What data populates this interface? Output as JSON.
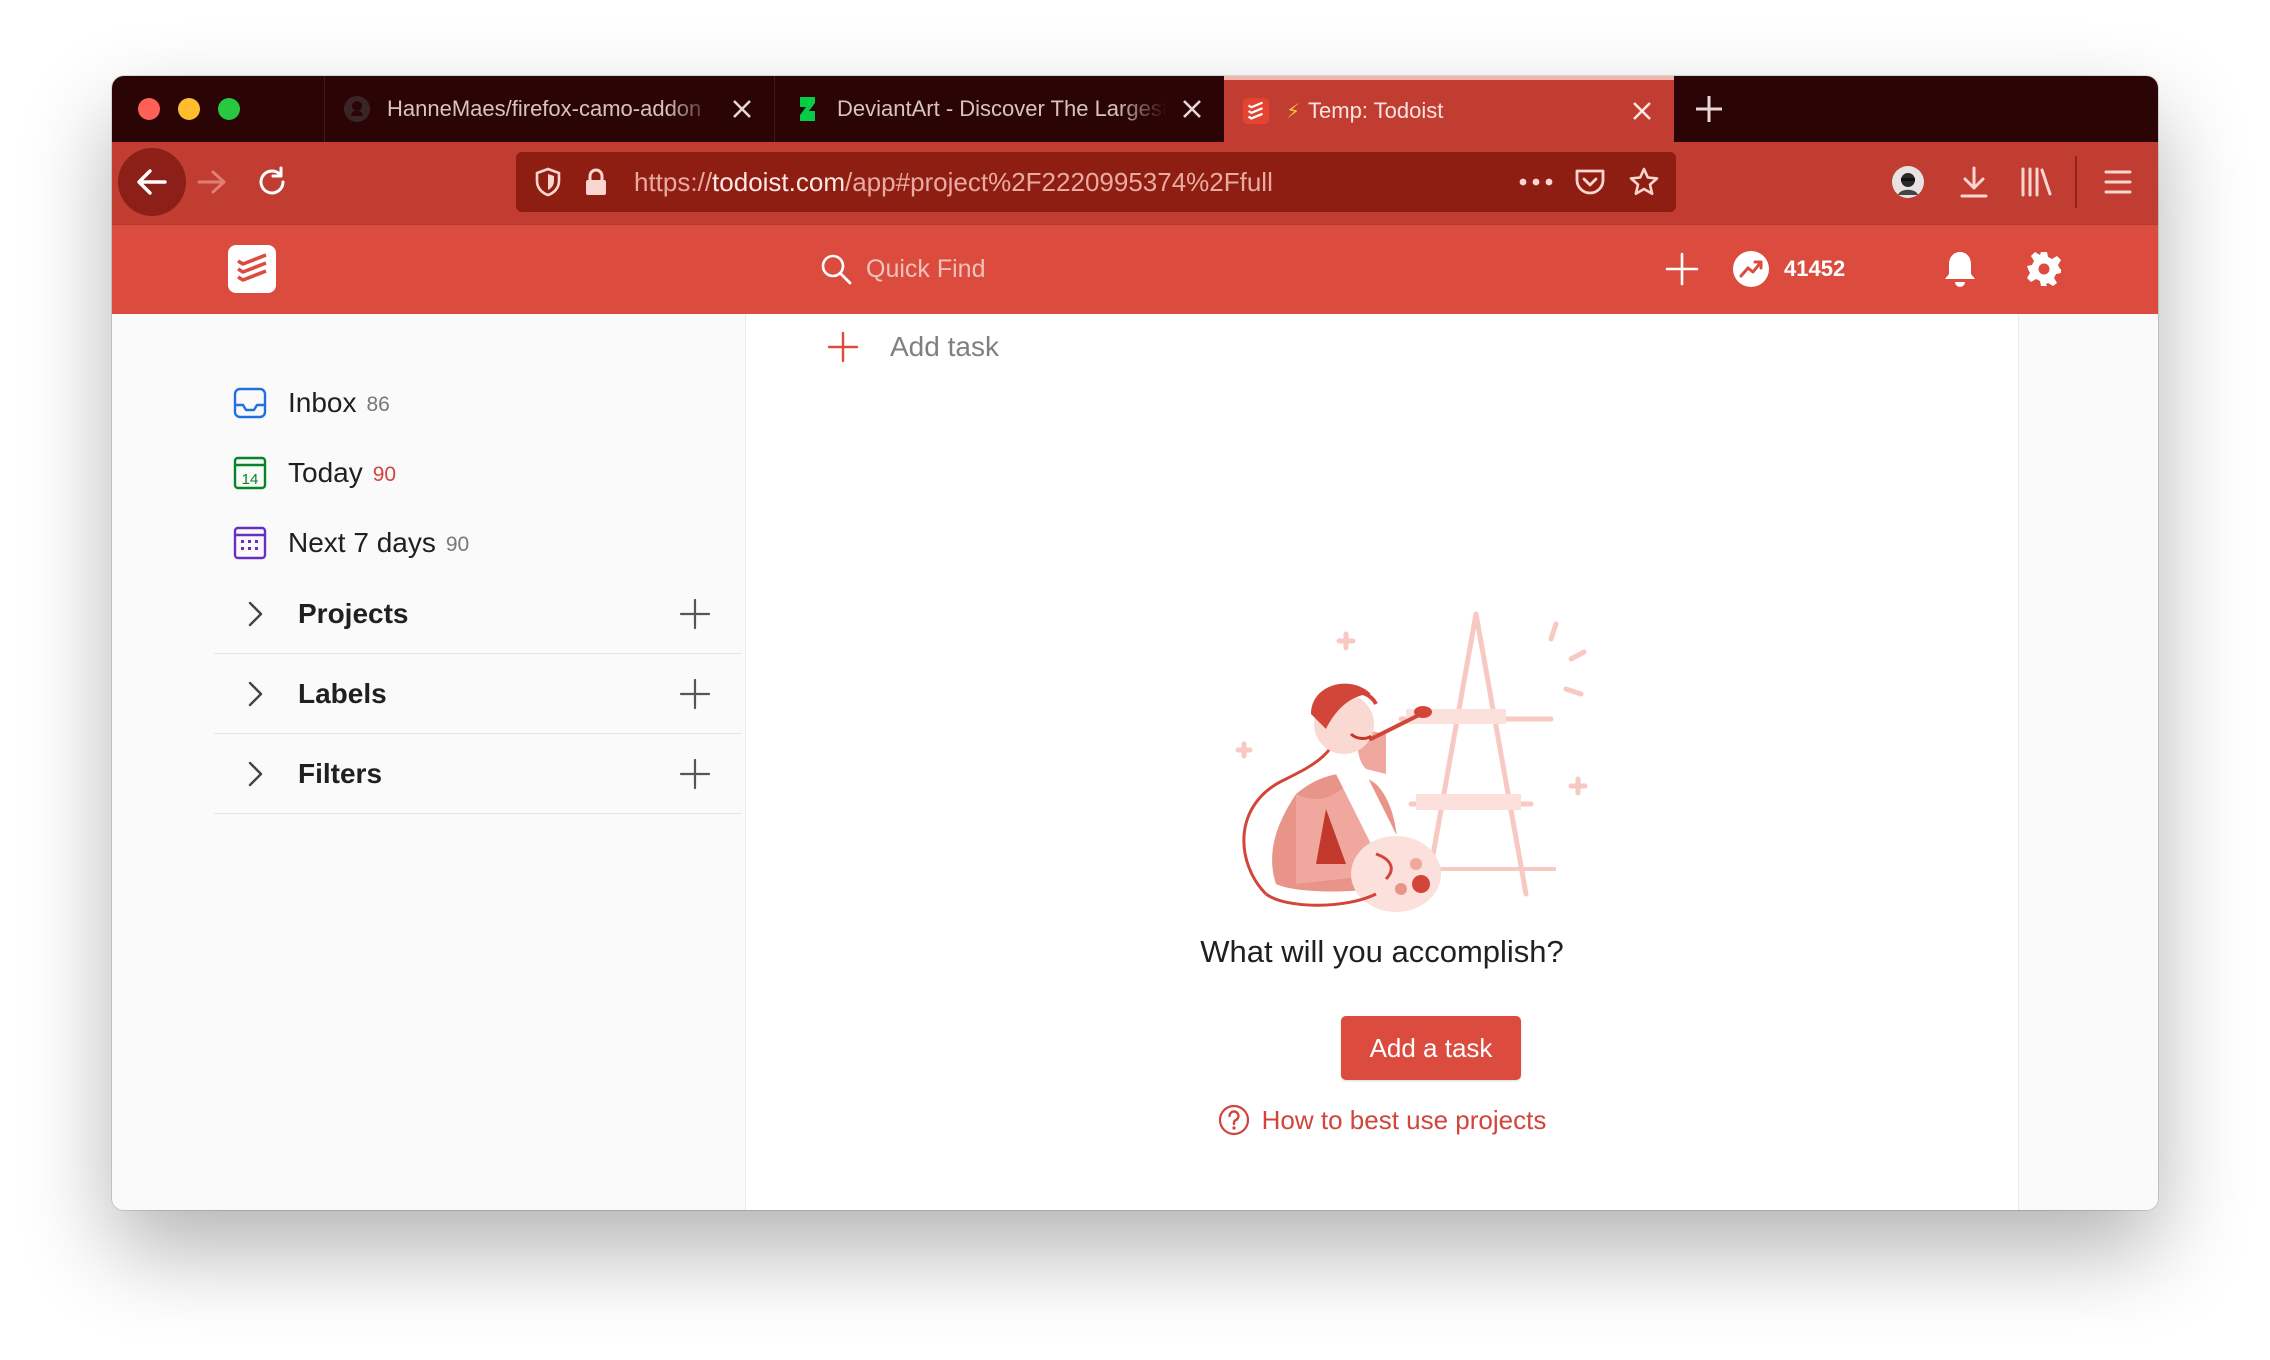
{
  "browser": {
    "tabs": [
      {
        "title": "HanneMaes/firefox-camo-addon",
        "favicon": "github-icon",
        "active": false
      },
      {
        "title": "DeviantArt - Discover The Largest",
        "favicon": "deviantart-icon",
        "active": false
      },
      {
        "title": "Temp: Todoist",
        "favicon": "todoist-icon",
        "prefix_glyph": "⚡",
        "active": true
      }
    ],
    "url": {
      "scheme": "https://",
      "host": "todoist.com",
      "path": "/app#project%2F2220995374%2Ffull"
    },
    "toolbar_icons": [
      "back-icon",
      "forward-icon",
      "reload-icon",
      "shield-icon",
      "lock-icon",
      "more-icon",
      "pocket-icon",
      "star-icon",
      "account-avatar",
      "download-icon",
      "library-icon",
      "menu-icon"
    ]
  },
  "header": {
    "search_placeholder": "Quick Find",
    "karma": "41452",
    "icons": [
      "todoist-logo",
      "search-icon",
      "add-icon",
      "karma-icon",
      "bell-icon",
      "gear-icon"
    ]
  },
  "sidebar": {
    "filters": [
      {
        "label": "Inbox",
        "count": "86",
        "icon": "inbox-icon",
        "color": "#246fe0"
      },
      {
        "label": "Today",
        "count": "90",
        "icon": "calendar-today-icon",
        "color": "#058527",
        "count_color": "#d1453b"
      },
      {
        "label": "Next 7 days",
        "count": "90",
        "icon": "calendar-week-icon",
        "color": "#692fc2"
      }
    ],
    "sections": [
      {
        "label": "Projects"
      },
      {
        "label": "Labels"
      },
      {
        "label": "Filters"
      }
    ]
  },
  "main": {
    "add_task_label": "Add task",
    "empty_title": "What will you accomplish?",
    "cta_label": "Add a task",
    "help_link": "How to best use projects"
  },
  "colors": {
    "tabstrip": "#2b0405",
    "toolbar": "#c13d32",
    "urlbar": "#8f1e12",
    "brand": "#db4c3f",
    "link": "#d1453b"
  }
}
